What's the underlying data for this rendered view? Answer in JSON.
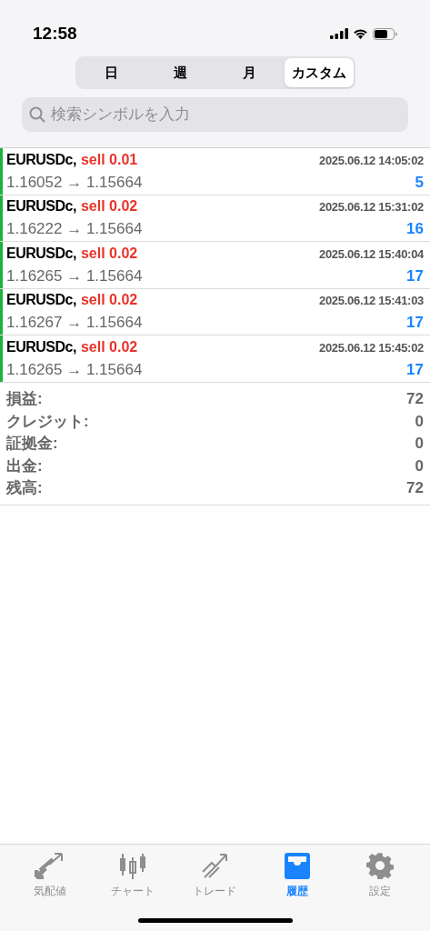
{
  "status_bar": {
    "time": "12:58"
  },
  "period_tabs": [
    {
      "label": "日",
      "selected": false
    },
    {
      "label": "週",
      "selected": false
    },
    {
      "label": "月",
      "selected": false
    },
    {
      "label": "カスタム",
      "selected": true
    }
  ],
  "search": {
    "placeholder": "検索シンボルを入力"
  },
  "deals": [
    {
      "symbol": "EURUSDc,",
      "side": "sell",
      "lots": "0.01",
      "time": "2025.06.12 14:05:02",
      "prices": "1.16052 → 1.15664",
      "profit": "5"
    },
    {
      "symbol": "EURUSDc,",
      "side": "sell",
      "lots": "0.02",
      "time": "2025.06.12 15:31:02",
      "prices": "1.16222 → 1.15664",
      "profit": "16"
    },
    {
      "symbol": "EURUSDc,",
      "side": "sell",
      "lots": "0.02",
      "time": "2025.06.12 15:40:04",
      "prices": "1.16265 → 1.15664",
      "profit": "17"
    },
    {
      "symbol": "EURUSDc,",
      "side": "sell",
      "lots": "0.02",
      "time": "2025.06.12 15:41:03",
      "prices": "1.16267 → 1.15664",
      "profit": "17"
    },
    {
      "symbol": "EURUSDc,",
      "side": "sell",
      "lots": "0.02",
      "time": "2025.06.12 15:45:02",
      "prices": "1.16265 → 1.15664",
      "profit": "17"
    }
  ],
  "summary": [
    {
      "label": "損益:",
      "value": "72"
    },
    {
      "label": "クレジット:",
      "value": "0"
    },
    {
      "label": "証拠金:",
      "value": "0"
    },
    {
      "label": "出金:",
      "value": "0"
    },
    {
      "label": "残高:",
      "value": "72"
    }
  ],
  "tab_bar": [
    {
      "label": "気配値",
      "kind": "quotes",
      "selected": false
    },
    {
      "label": "チャート",
      "kind": "chart",
      "selected": false
    },
    {
      "label": "トレード",
      "kind": "trade",
      "selected": false
    },
    {
      "label": "履歴",
      "kind": "history",
      "selected": true
    },
    {
      "label": "設定",
      "kind": "settings",
      "selected": false
    }
  ]
}
